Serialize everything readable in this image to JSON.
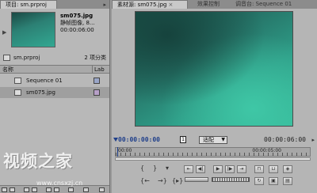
{
  "project_panel": {
    "tab_title": "项目: sm.prproj",
    "preview": {
      "file_name": "sm075.jpg",
      "file_type": "静帧图像, 8...",
      "duration": "00:00:06:00"
    },
    "project_file": "sm.prproj",
    "item_count": "2 项分类",
    "columns": {
      "name": "名称",
      "label": "Lab"
    },
    "items": [
      {
        "name": "Sequence 01",
        "label_color": "#9aa6c8"
      },
      {
        "name": "sm075.jpg",
        "label_color": "#b7a0c8"
      }
    ]
  },
  "monitor_panel": {
    "tabs": [
      {
        "label": "素材源: sm075.jpg",
        "close": "×"
      },
      {
        "label": "效果控制"
      },
      {
        "label": "调音台: Sequence 01"
      }
    ],
    "current_timecode": "00:00:00:00",
    "fit_box": "1",
    "fit_select": "适配",
    "duration_timecode": "00:00:06:00",
    "ruler_start": "00:00",
    "ruler_end": "00:00:05:00"
  },
  "watermark": {
    "title": "视频之家",
    "url": "www.cnsxzj.cn"
  }
}
